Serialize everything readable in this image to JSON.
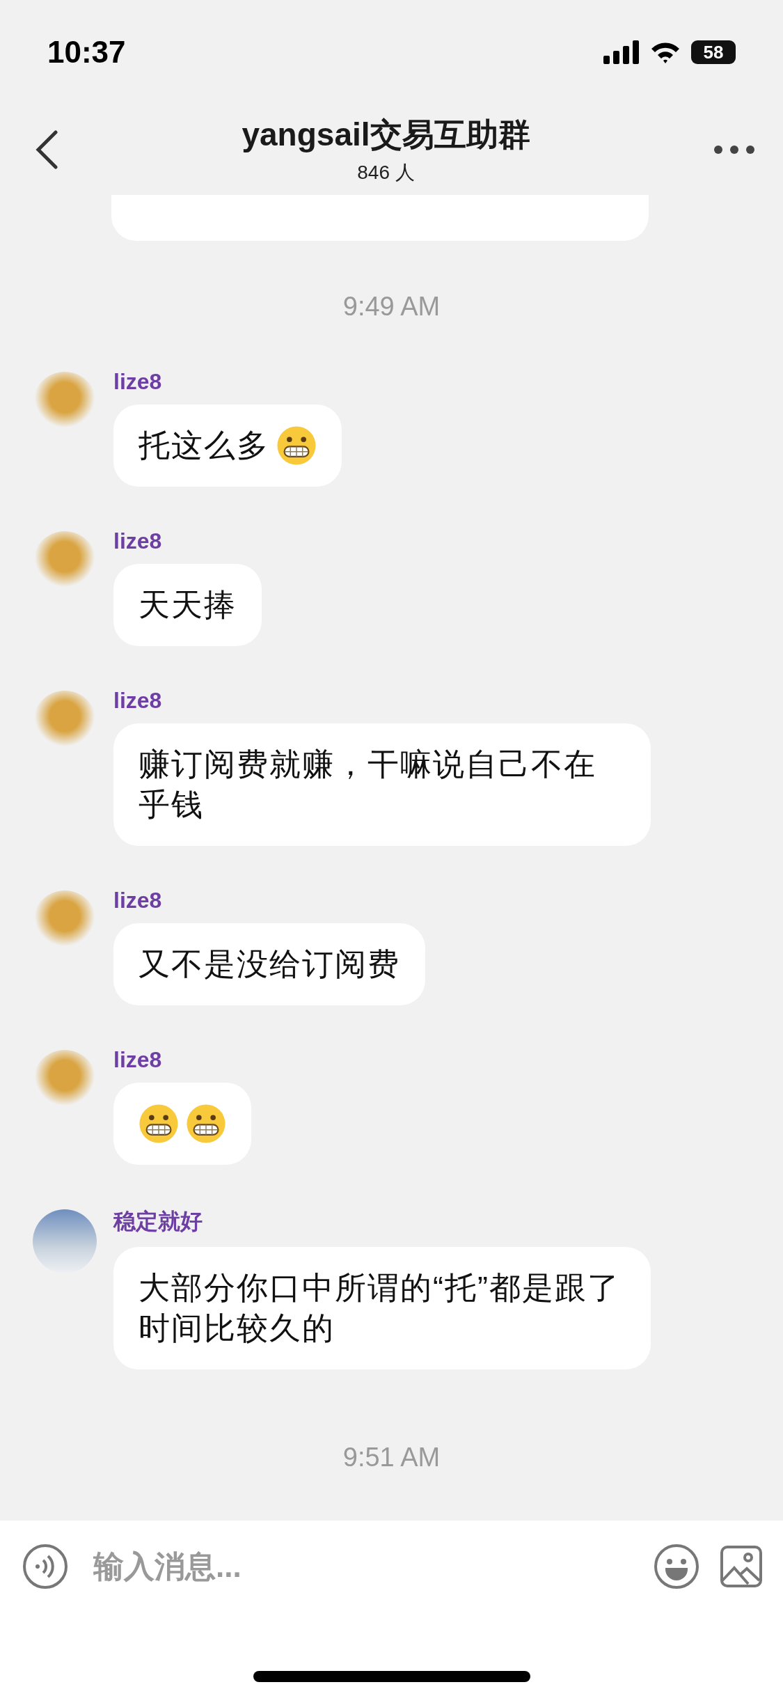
{
  "status_bar": {
    "time": "10:37",
    "battery": "58"
  },
  "header": {
    "title": "yangsail交易互助群",
    "subtitle": "846 人"
  },
  "chat": [
    {
      "kind": "cut_bubble"
    },
    {
      "kind": "time",
      "text": "9:49 AM"
    },
    {
      "kind": "message",
      "sender": "lize8",
      "avatar": {
        "kind": "umbrella"
      },
      "text": "托这么多",
      "emojis": [
        {
          "kind": "grimacing"
        }
      ]
    },
    {
      "kind": "message",
      "sender": "lize8",
      "avatar": {
        "kind": "umbrella"
      },
      "text": "天天捧"
    },
    {
      "kind": "message",
      "sender": "lize8",
      "avatar": {
        "kind": "umbrella"
      },
      "text": "赚订阅费就赚，干嘛说自己不在乎钱"
    },
    {
      "kind": "message",
      "sender": "lize8",
      "avatar": {
        "kind": "umbrella"
      },
      "text": "又不是没给订阅费"
    },
    {
      "kind": "message",
      "sender": "lize8",
      "avatar": {
        "kind": "umbrella"
      },
      "emojis": [
        {
          "kind": "grimacing"
        },
        {
          "kind": "grimacing"
        }
      ]
    },
    {
      "kind": "message",
      "sender": "稳定就好",
      "avatar": {
        "kind": "photo"
      },
      "text": "大部分你口中所谓的“托”都是跟了时间比较久的"
    },
    {
      "kind": "time",
      "text": "9:51 AM"
    }
  ],
  "composer": {
    "placeholder": "输入消息..."
  }
}
